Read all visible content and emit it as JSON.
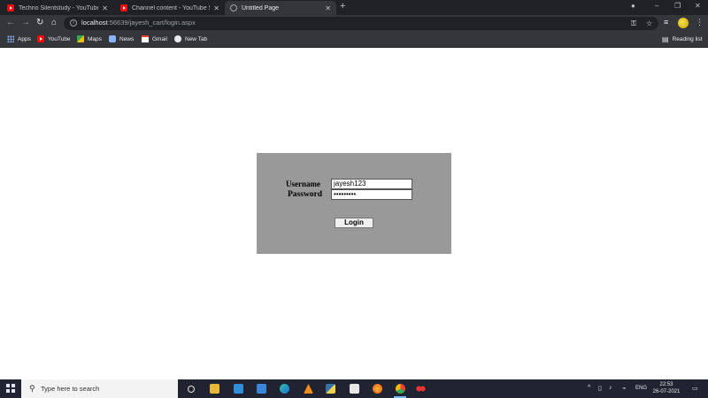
{
  "browser": {
    "tabs": [
      {
        "title": "Techno Silentstudy - YouTube",
        "active": false,
        "icon": "youtube-icon"
      },
      {
        "title": "Channel content - YouTube Studio",
        "active": false,
        "icon": "youtube-icon"
      },
      {
        "title": "Untitled Page",
        "active": true,
        "icon": "globe-icon"
      }
    ],
    "address": {
      "host": "localhost",
      "path": ":56639/jayesh_cart/login.aspx"
    },
    "bookmarks": [
      {
        "label": "Apps",
        "icon": "apps-grid-icon"
      },
      {
        "label": "YouTube",
        "icon": "youtube-icon"
      },
      {
        "label": "Maps",
        "icon": "maps-icon"
      },
      {
        "label": "News",
        "icon": "news-icon"
      },
      {
        "label": "Gmail",
        "icon": "gmail-icon"
      },
      {
        "label": "New Tab",
        "icon": "new-tab-icon"
      }
    ],
    "reading_list": "Reading list"
  },
  "login": {
    "username_label": "Username",
    "password_label": "Password",
    "username_value": "jayesh123",
    "password_value": "•••••••••",
    "button_label": "Login",
    "panel_color": "#999999"
  },
  "taskbar": {
    "search_placeholder": "Type here to search",
    "language": "ENG",
    "time": "22:53",
    "date": "26-07-2021"
  }
}
